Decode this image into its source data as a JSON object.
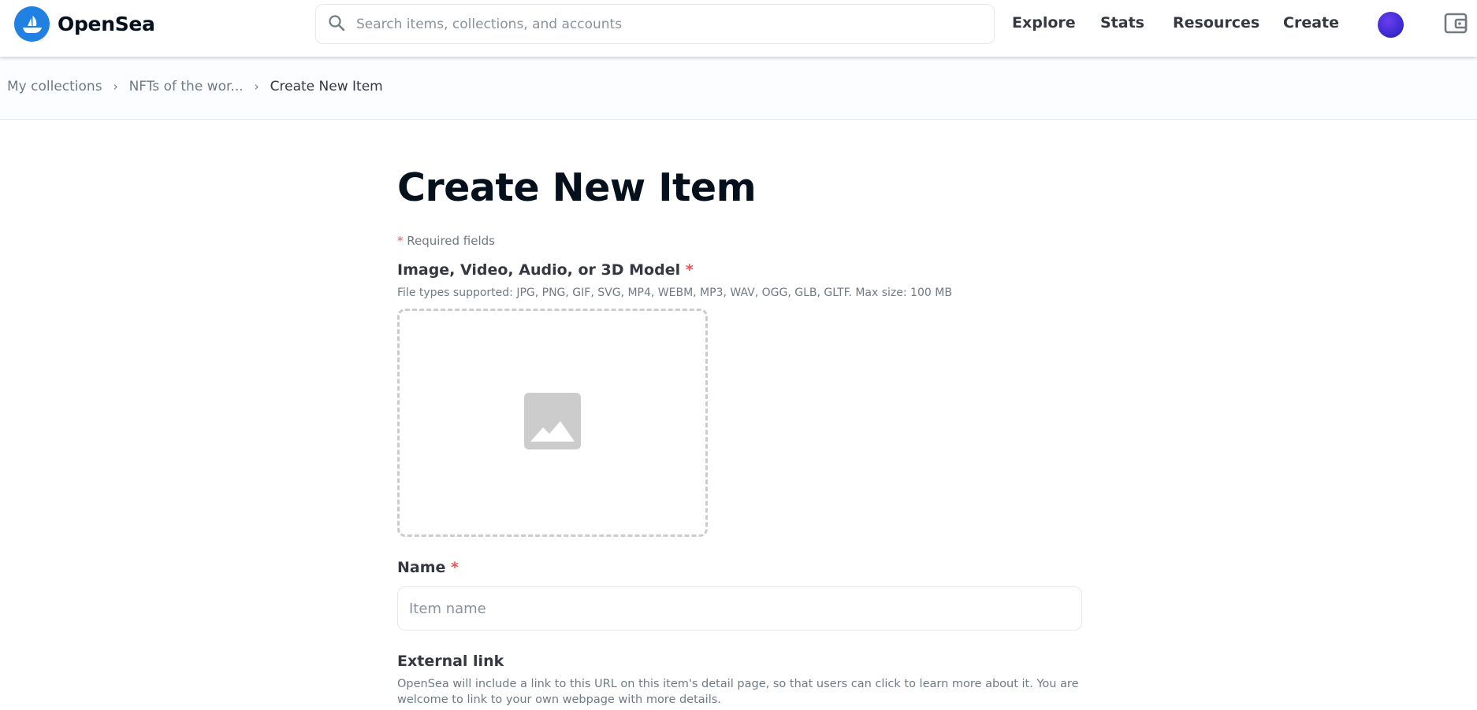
{
  "header": {
    "logo_text": "OpenSea",
    "search_placeholder": "Search items, collections, and accounts",
    "nav": {
      "explore": "Explore",
      "stats": "Stats",
      "resources": "Resources",
      "create": "Create"
    }
  },
  "breadcrumb": {
    "items": [
      "My collections",
      "NFTs of the wor..."
    ],
    "current": "Create New Item"
  },
  "form": {
    "title": "Create New Item",
    "required_mark": "*",
    "required_note": "Required fields",
    "media": {
      "label": "Image, Video, Audio, or 3D Model",
      "description": "File types supported: JPG, PNG, GIF, SVG, MP4, WEBM, MP3, WAV, OGG, GLB, GLTF. Max size: 100 MB"
    },
    "name": {
      "label": "Name",
      "placeholder": "Item name"
    },
    "external_link": {
      "label": "External link",
      "description": "OpenSea will include a link to this URL on this item's detail page, so that users can click to learn more about it. You are welcome to link to your own webpage with more details."
    }
  },
  "colors": {
    "brand": "#2081e2",
    "required": "#eb5757",
    "text_primary": "#04111d",
    "text_secondary": "#707a83"
  }
}
